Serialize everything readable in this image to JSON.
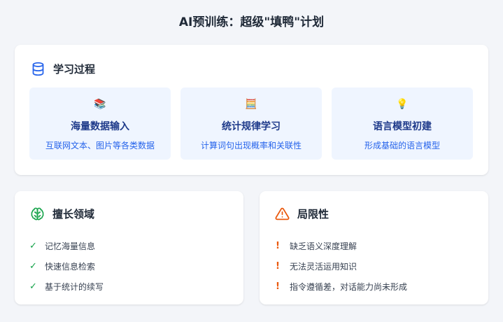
{
  "page_title": "AI预训练：超级\"填鸭\"计划",
  "process": {
    "title": "学习过程",
    "icon": "database-icon",
    "steps": [
      {
        "emoji": "📚",
        "title": "海量数据输入",
        "desc": "互联网文本、图片等各类数据"
      },
      {
        "emoji": "🧮",
        "title": "统计规律学习",
        "desc": "计算词句出现概率和关联性"
      },
      {
        "emoji": "💡",
        "title": "语言模型初建",
        "desc": "形成基础的语言模型"
      }
    ]
  },
  "strengths": {
    "title": "擅长领域",
    "icon": "brain-icon",
    "mark": "✓",
    "items": [
      "记忆海量信息",
      "快速信息检索",
      "基于统计的续写"
    ]
  },
  "limitations": {
    "title": "局限性",
    "icon": "warning-triangle-icon",
    "mark": "!",
    "items": [
      "缺乏语义深度理解",
      "无法灵活运用知识",
      "指令遵循差，对话能力尚未形成"
    ]
  },
  "colors": {
    "accent_blue": "#2563eb",
    "tile_bg": "#eff5ff",
    "check_green": "#16a34a",
    "warning_orange": "#ea580c"
  }
}
